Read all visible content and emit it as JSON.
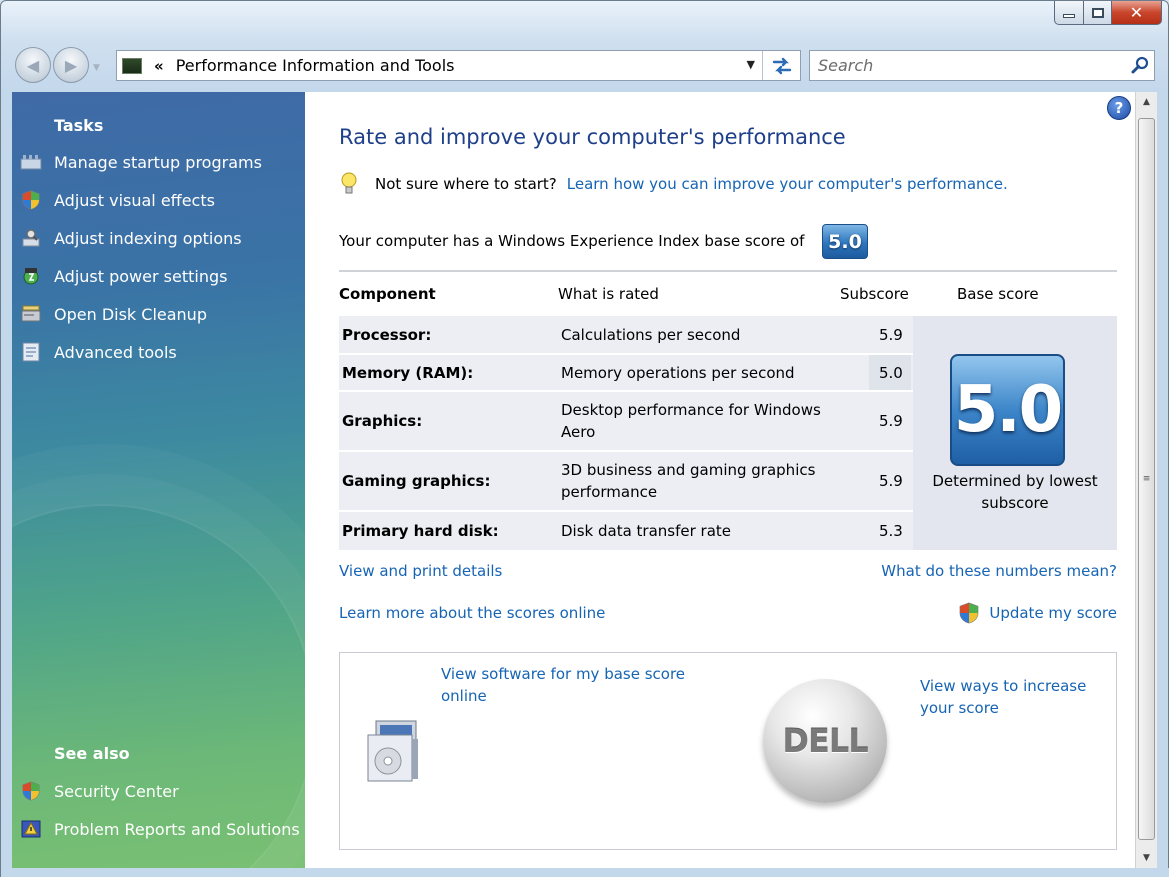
{
  "window": {
    "caption": {
      "minimize": "",
      "maximize": "",
      "close": "✕"
    }
  },
  "nav": {
    "back": "◀",
    "forward": "▶",
    "history_drop": "▼",
    "address_chevrons": "«",
    "address_text": "Performance Information and Tools",
    "address_drop": "▼",
    "refresh": "↹"
  },
  "search": {
    "placeholder": "Search"
  },
  "sidebar": {
    "tasks_heading": "Tasks",
    "items": [
      {
        "label": "Manage startup programs",
        "icon": "startup-programs-icon"
      },
      {
        "label": "Adjust visual effects",
        "icon": "shield-icon"
      },
      {
        "label": "Adjust indexing options",
        "icon": "indexing-icon"
      },
      {
        "label": "Adjust power settings",
        "icon": "power-icon"
      },
      {
        "label": "Open Disk Cleanup",
        "icon": "disk-cleanup-icon"
      },
      {
        "label": "Advanced tools",
        "icon": "advanced-tools-icon"
      }
    ],
    "see_also_heading": "See also",
    "see_also": [
      {
        "label": "Security Center",
        "icon": "security-shield-icon"
      },
      {
        "label": "Problem Reports and Solutions",
        "icon": "problem-reports-icon"
      }
    ]
  },
  "content": {
    "help": "?",
    "title": "Rate and improve your computer's performance",
    "tip_text": "Not sure where to start?",
    "tip_link": "Learn how you can improve your computer's performance.",
    "score_text": "Your computer has a Windows Experience Index base score of",
    "base_score": "5.0",
    "columns": {
      "component": "Component",
      "what": "What is rated",
      "subscore": "Subscore",
      "base": "Base score"
    },
    "rows": [
      {
        "component": "Processor:",
        "what": "Calculations per second",
        "subscore": "5.9"
      },
      {
        "component": "Memory (RAM):",
        "what": "Memory operations per second",
        "subscore": "5.0"
      },
      {
        "component": "Graphics:",
        "what": "Desktop performance for Windows Aero",
        "subscore": "5.9"
      },
      {
        "component": "Gaming graphics:",
        "what": "3D business and gaming graphics performance",
        "subscore": "5.9"
      },
      {
        "component": "Primary hard disk:",
        "what": "Disk data transfer rate",
        "subscore": "5.3"
      }
    ],
    "base_caption": "Determined by lowest subscore",
    "links": {
      "view_print": "View and print details",
      "what_numbers": "What do these numbers mean?",
      "learn_more": "Learn more about the scores online",
      "update": "Update my score"
    },
    "promo": {
      "software_link": "View software for my base score online",
      "increase_link": "View ways to increase your score",
      "brand": "DELL"
    }
  },
  "scrollbar": {
    "up": "▲",
    "down": "▼",
    "grip": "≡"
  }
}
